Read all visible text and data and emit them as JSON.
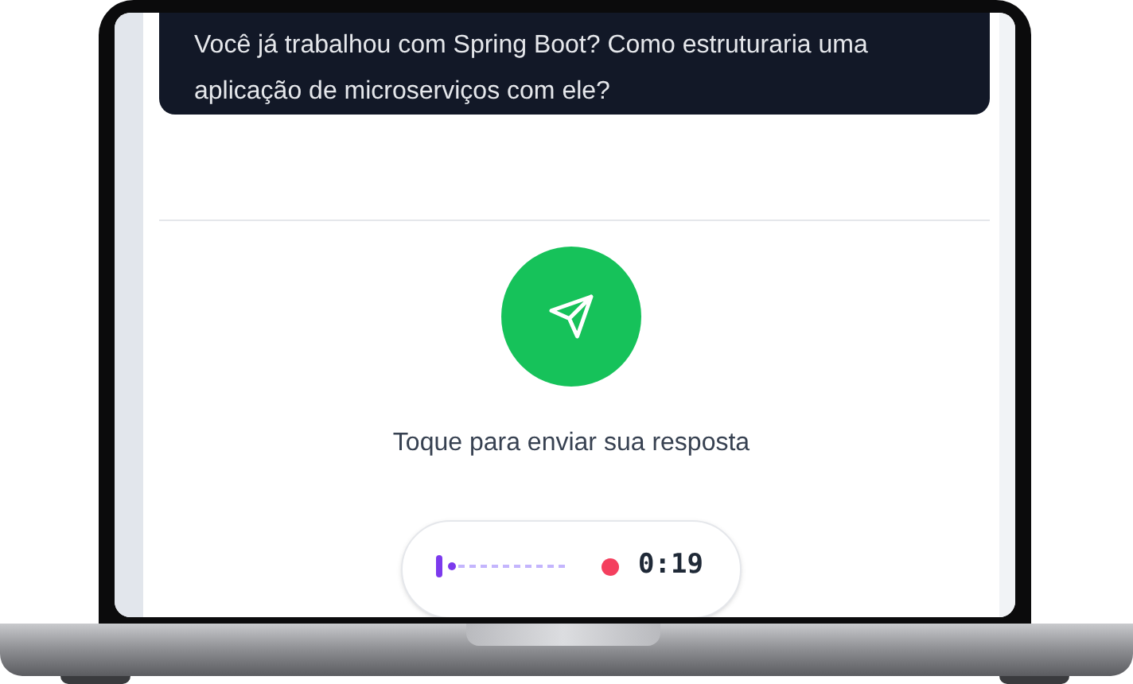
{
  "question": {
    "text": "Você já trabalhou com Spring Boot? Como estruturaria uma aplicação de microserviços com ele?"
  },
  "send": {
    "hint": "Toque para enviar sua resposta"
  },
  "recorder": {
    "recording": true,
    "time": "0:19"
  }
}
